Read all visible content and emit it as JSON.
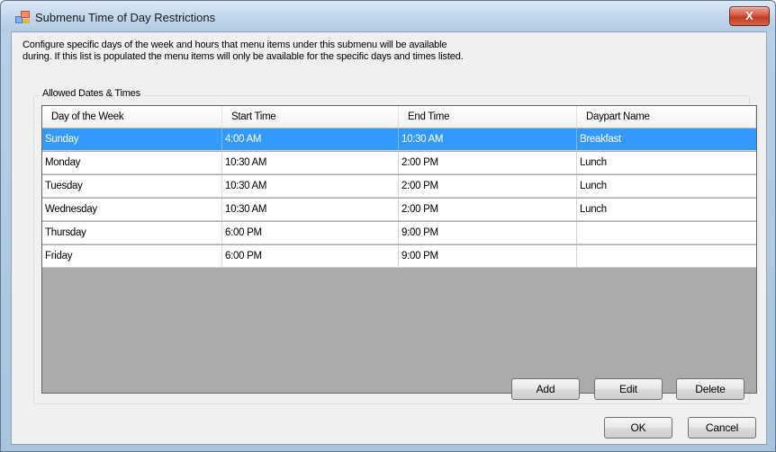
{
  "window": {
    "title": "Submenu Time of Day Restrictions",
    "close_label": "X"
  },
  "description": {
    "line1": "Configure specific days of the week and hours that menu items under this submenu will be available",
    "line2": "during. If this list is populated the menu items will only be available for the specific days and times listed."
  },
  "group": {
    "label": "Allowed Dates & Times"
  },
  "grid": {
    "columns": [
      "Day of the Week",
      "Start Time",
      "End Time",
      "Daypart Name"
    ],
    "rows": [
      {
        "day": "Sunday",
        "start": "4:00 AM",
        "end": "10:30 AM",
        "daypart": "Breakfast",
        "selected": true
      },
      {
        "day": "Monday",
        "start": "10:30 AM",
        "end": "2:00 PM",
        "daypart": "Lunch",
        "selected": false
      },
      {
        "day": "Tuesday",
        "start": "10:30 AM",
        "end": "2:00 PM",
        "daypart": "Lunch",
        "selected": false
      },
      {
        "day": "Wednesday",
        "start": "10:30 AM",
        "end": "2:00 PM",
        "daypart": "Lunch",
        "selected": false
      },
      {
        "day": "Thursday",
        "start": "6:00 PM",
        "end": "9:00 PM",
        "daypart": "",
        "selected": false
      },
      {
        "day": "Friday",
        "start": "6:00 PM",
        "end": "9:00 PM",
        "daypart": "",
        "selected": false
      }
    ]
  },
  "buttons": {
    "add": "Add",
    "edit": "Edit",
    "delete": "Delete",
    "ok": "OK",
    "cancel": "Cancel"
  },
  "colors": {
    "selection": "#3399ff",
    "grid_empty": "#ababab"
  }
}
